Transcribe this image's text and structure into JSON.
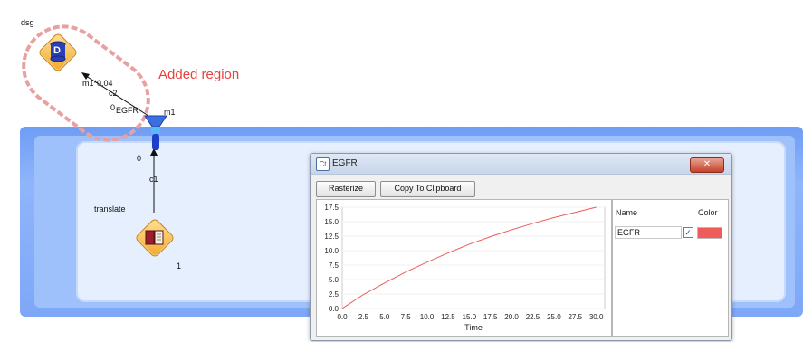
{
  "canvas": {
    "node_dsg": {
      "label": "dsg",
      "glyph": "D"
    },
    "node_translate": {
      "label": "translate"
    },
    "annotation": {
      "text": "Added region",
      "color": "#e84040"
    },
    "labels": {
      "m1_004": "m1*0.04",
      "c2": "c2",
      "zero_top": "0",
      "egfr": "EGFR",
      "m1": "m1",
      "zero_bottom": "0",
      "c1": "c1",
      "one": "1"
    }
  },
  "dialog": {
    "title": "EGFR",
    "app_icon": "Ct",
    "close_glyph": "✕",
    "buttons": {
      "rasterize": "Rasterize",
      "copy": "Copy To Clipboard"
    },
    "legend": {
      "name_header": "Name",
      "color_header": "Color",
      "items": [
        {
          "name": "EGFR",
          "checked": "✓",
          "color": "#ef5b5b"
        }
      ]
    }
  },
  "chart_data": {
    "type": "line",
    "xlabel": "Time",
    "ylabel": "",
    "title": "",
    "xlim": [
      0,
      31
    ],
    "ylim": [
      0,
      17.5
    ],
    "xticks": [
      "0.0",
      "2.5",
      "5.0",
      "7.5",
      "10.0",
      "12.5",
      "15.0",
      "17.5",
      "20.0",
      "22.5",
      "25.0",
      "27.5",
      "30.0"
    ],
    "yticks": [
      "0.0",
      "2.5",
      "5.0",
      "7.5",
      "10.0",
      "12.5",
      "15.0",
      "17.5"
    ],
    "series": [
      {
        "name": "EGFR",
        "color": "#ef5b5b",
        "x": [
          0,
          2.5,
          5,
          7.5,
          10,
          12.5,
          15,
          17.5,
          20,
          22.5,
          25,
          27.5,
          30
        ],
        "y": [
          0,
          2.4,
          4.4,
          6.3,
          8.0,
          9.6,
          11.1,
          12.4,
          13.6,
          14.7,
          15.7,
          16.6,
          17.5
        ]
      }
    ]
  }
}
